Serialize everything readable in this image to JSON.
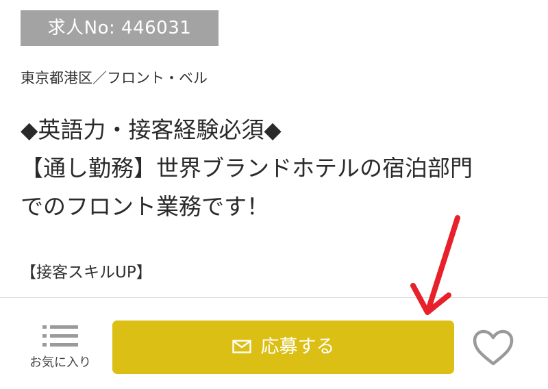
{
  "job": {
    "id_label": "求人No: 446031",
    "location": "東京都港区／フロント・ベル",
    "title_lines": [
      "◆英語力・接客経験必須◆",
      "【通し勤務】世界ブランドホテルの宿泊部門",
      "でのフロント業務です！"
    ],
    "tagline": "【接客スキルUP】"
  },
  "bottom_bar": {
    "favorites_label": "お気に入り",
    "favorites_icon": "list-icon",
    "apply_label": "応募する",
    "apply_icon": "mail-icon",
    "heart_icon": "heart-outline-icon"
  },
  "colors": {
    "badge_bg": "#a3a3a3",
    "apply_bg": "#dcbf14",
    "arrow": "#e8202a",
    "icon_gray": "#9a9a9a"
  }
}
